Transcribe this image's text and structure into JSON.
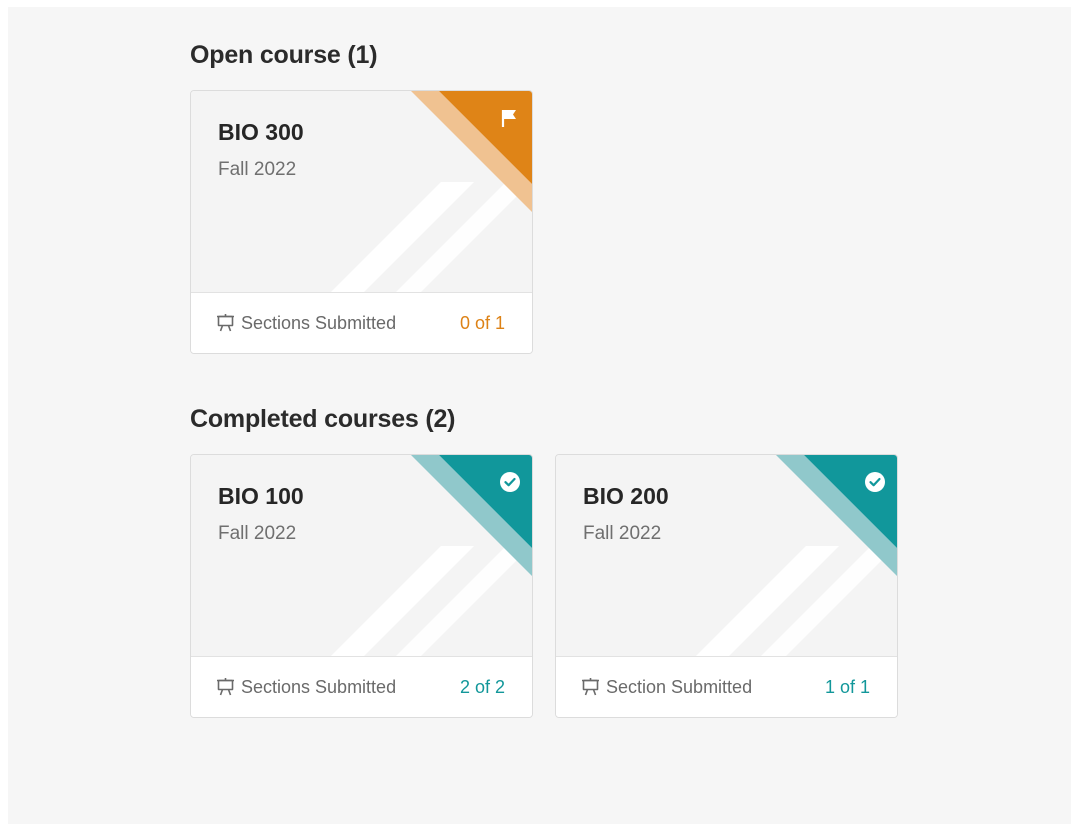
{
  "colors": {
    "open_accent": "#df8417",
    "open_stripe": "#f0c291",
    "completed_accent": "#11979b",
    "completed_stripe": "#90c8cb"
  },
  "open_section": {
    "title": "Open course (1)",
    "cards": [
      {
        "code": "BIO 300",
        "term": "Fall 2022",
        "badge_icon": "flag-icon",
        "footer_icon": "presentation-board-icon",
        "footer_label": "Sections Submitted",
        "count": "0 of 1"
      }
    ]
  },
  "completed_section": {
    "title": "Completed courses (2)",
    "cards": [
      {
        "code": "BIO 100",
        "term": "Fall 2022",
        "badge_icon": "check-circle-icon",
        "footer_icon": "presentation-board-icon",
        "footer_label": "Sections Submitted",
        "count": "2 of 2"
      },
      {
        "code": "BIO 200",
        "term": "Fall 2022",
        "badge_icon": "check-circle-icon",
        "footer_icon": "presentation-board-icon",
        "footer_label": "Section Submitted",
        "count": "1 of 1"
      }
    ]
  }
}
